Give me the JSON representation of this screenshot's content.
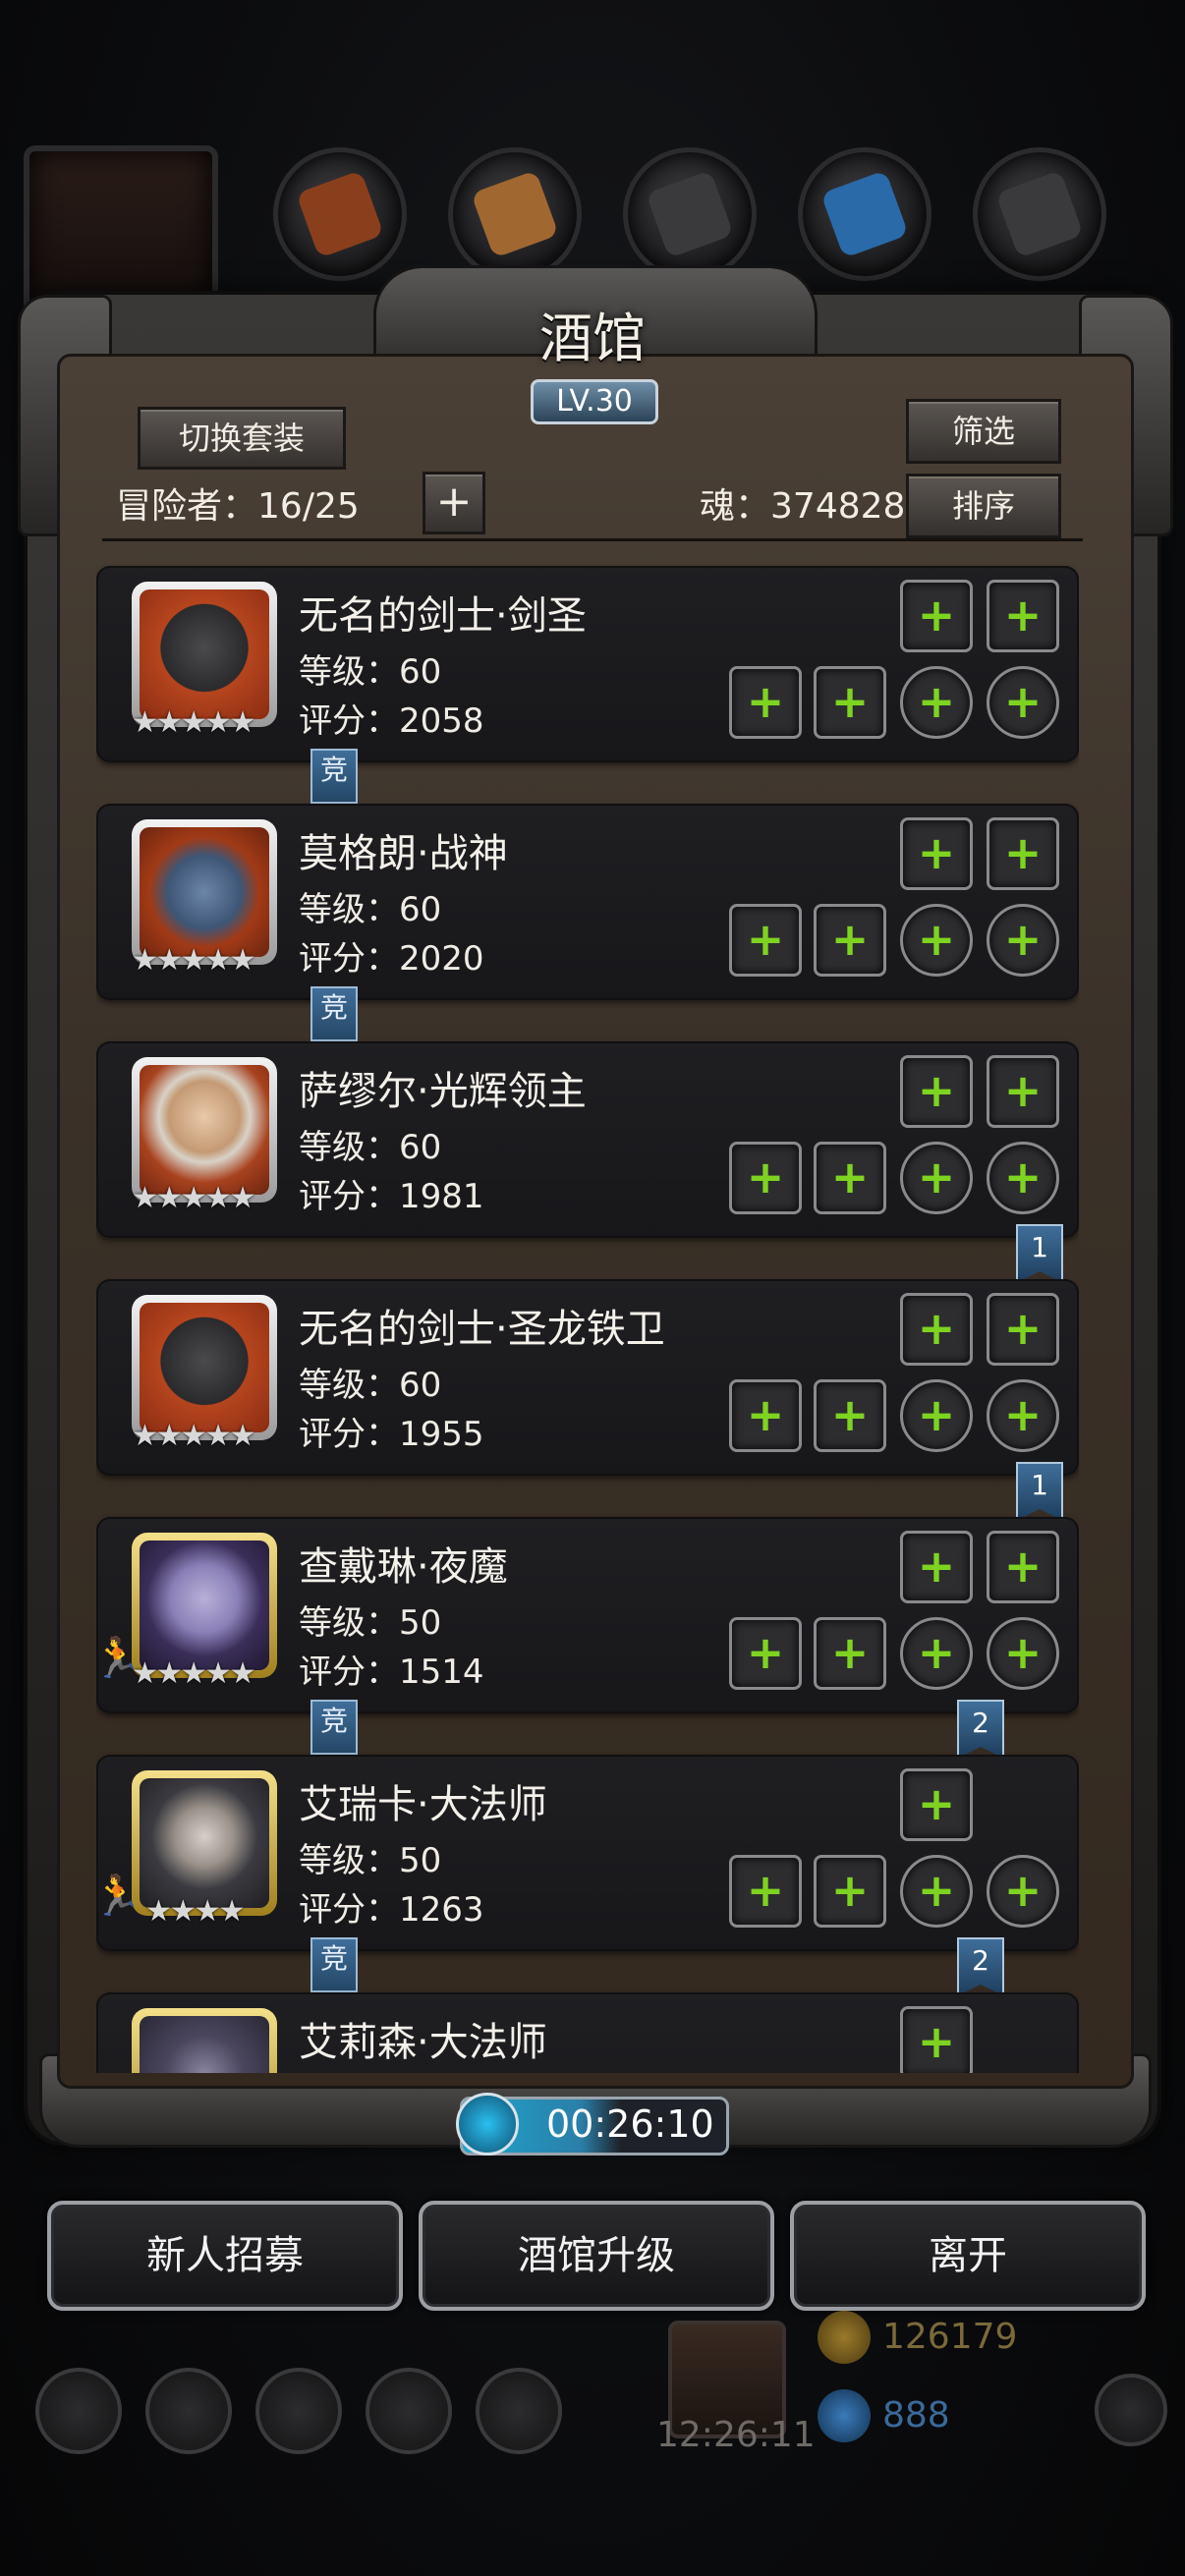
{
  "window": {
    "title": "酒馆",
    "level_badge": "LV.30"
  },
  "header": {
    "switch_outfit_label": "切换套装",
    "filter_label": "筛选",
    "sort_label": "排序",
    "adventurer_label": "冒险者：",
    "adventurer_count": "16/25",
    "add_label": "+",
    "soul_label": "魂：",
    "soul_value": "374828"
  },
  "heroes": [
    {
      "name": "无名的剑士·剑圣",
      "level": "等级：60",
      "score": "评分：2058",
      "stars": "★★★★★",
      "tag": "竞",
      "rank": ""
    },
    {
      "name": "莫格朗·战神",
      "level": "等级：60",
      "score": "评分：2020",
      "stars": "★★★★★",
      "tag": "竞",
      "rank": ""
    },
    {
      "name": "萨缪尔·光辉领主",
      "level": "等级：60",
      "score": "评分：1981",
      "stars": "★★★★★",
      "tag": "",
      "rank": "1"
    },
    {
      "name": "无名的剑士·圣龙铁卫",
      "level": "等级：60",
      "score": "评分：1955",
      "stars": "★★★★★",
      "tag": "",
      "rank": "1"
    },
    {
      "name": "查戴琳·夜魔",
      "level": "等级：50",
      "score": "评分：1514",
      "stars": "★★★★★",
      "tag": "竞",
      "rank": "2"
    },
    {
      "name": "艾瑞卡·大法师",
      "level": "等级：50",
      "score": "评分：1263",
      "stars": "★★★★",
      "tag": "竞",
      "rank": "2"
    },
    {
      "name": "艾莉森·大法师",
      "level": "",
      "score": "",
      "stars": "",
      "tag": "",
      "rank": ""
    }
  ],
  "timer": {
    "value": "00:26:10"
  },
  "buttons": {
    "recruit": "新人招募",
    "upgrade": "酒馆升级",
    "leave": "离开"
  },
  "background_hud": {
    "clock": "12:26:11",
    "gold": "126179",
    "gems": "888"
  },
  "icons": {
    "equip_plus": "+",
    "runner": "runner-icon"
  },
  "colors": {
    "accent_green": "#7ed321",
    "tag_blue": "#3f6e9a"
  }
}
